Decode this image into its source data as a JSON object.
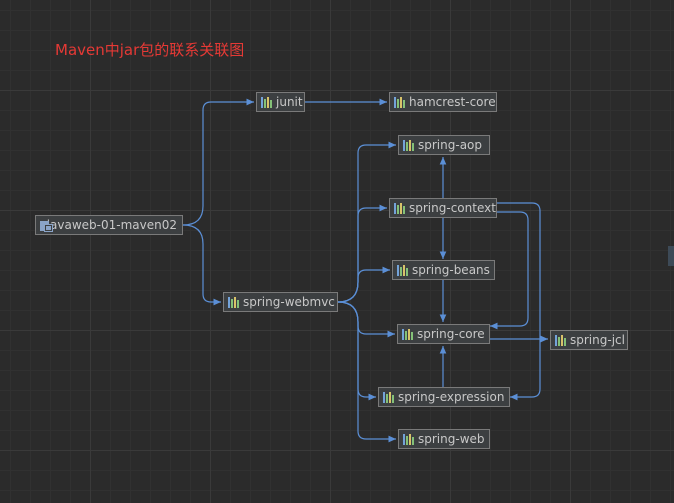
{
  "title": "Maven中jar包的联系关联图",
  "colors": {
    "edge": "#5b8fd6",
    "title": "#e53935",
    "node_border": "#7a7a7a",
    "background": "#2b2b2b"
  },
  "nodes": {
    "root": {
      "label": "javaweb-01-maven02",
      "icon": "module-icon"
    },
    "junit": {
      "label": "junit",
      "icon": "jar-icon"
    },
    "hamcrest": {
      "label": "hamcrest-core",
      "icon": "jar-icon"
    },
    "aop": {
      "label": "spring-aop",
      "icon": "jar-icon"
    },
    "context": {
      "label": "spring-context",
      "icon": "jar-icon"
    },
    "beans": {
      "label": "spring-beans",
      "icon": "jar-icon"
    },
    "webmvc": {
      "label": "spring-webmvc",
      "icon": "jar-icon"
    },
    "core": {
      "label": "spring-core",
      "icon": "jar-icon"
    },
    "jcl": {
      "label": "spring-jcl",
      "icon": "jar-icon"
    },
    "expression": {
      "label": "spring-expression",
      "icon": "jar-icon"
    },
    "web": {
      "label": "spring-web",
      "icon": "jar-icon"
    }
  },
  "edges": [
    {
      "from": "root",
      "to": "junit"
    },
    {
      "from": "root",
      "to": "webmvc"
    },
    {
      "from": "junit",
      "to": "hamcrest"
    },
    {
      "from": "webmvc",
      "to": "aop"
    },
    {
      "from": "webmvc",
      "to": "context"
    },
    {
      "from": "webmvc",
      "to": "beans"
    },
    {
      "from": "webmvc",
      "to": "core"
    },
    {
      "from": "webmvc",
      "to": "expression"
    },
    {
      "from": "webmvc",
      "to": "web"
    },
    {
      "from": "context",
      "to": "aop"
    },
    {
      "from": "context",
      "to": "beans"
    },
    {
      "from": "context",
      "to": "core"
    },
    {
      "from": "context",
      "to": "expression"
    },
    {
      "from": "beans",
      "to": "core"
    },
    {
      "from": "expression",
      "to": "core"
    },
    {
      "from": "core",
      "to": "jcl"
    }
  ]
}
